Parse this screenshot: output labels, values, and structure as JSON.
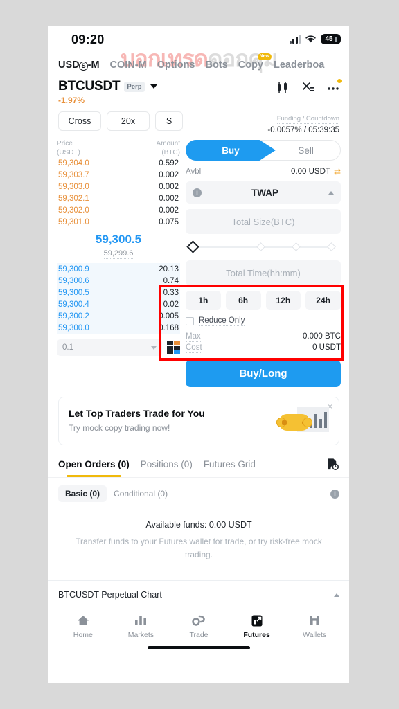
{
  "status_bar": {
    "time": "09:20",
    "battery": "45"
  },
  "watermark": {
    "part1": "บอกเทรด",
    "part2": "ดอกคุม"
  },
  "top_nav": {
    "items": [
      {
        "label_a": "USD",
        "label_b": "S",
        "label_c": "-M",
        "active": true
      },
      {
        "label": "COIN-M"
      },
      {
        "label": "Options"
      },
      {
        "label": "Bots"
      },
      {
        "label": "Copy",
        "badge": "New"
      },
      {
        "label": "Leaderboa"
      }
    ]
  },
  "ticker": {
    "symbol": "BTCUSDT",
    "perp_tag": "Perp",
    "change": "-1.97%",
    "chips": [
      "Cross",
      "20x",
      "S"
    ],
    "funding_label": "Funding / Countdown",
    "funding_value": "-0.0057% / 05:39:35"
  },
  "orderbook": {
    "head_price": "Price",
    "head_price_unit": "(USDT)",
    "head_amount": "Amount",
    "head_amount_unit": "(BTC)",
    "asks": [
      {
        "price": "59,304.0",
        "amount": "0.592"
      },
      {
        "price": "59,303.7",
        "amount": "0.002"
      },
      {
        "price": "59,303.0",
        "amount": "0.002"
      },
      {
        "price": "59,302.1",
        "amount": "0.002"
      },
      {
        "price": "59,302.0",
        "amount": "0.002"
      },
      {
        "price": "59,301.0",
        "amount": "0.075"
      }
    ],
    "mark_price": "59,300.5",
    "index_price": "59,299.6",
    "bids": [
      {
        "price": "59,300.9",
        "amount": "20.13"
      },
      {
        "price": "59,300.6",
        "amount": "0.74"
      },
      {
        "price": "59,300.5",
        "amount": "0.33"
      },
      {
        "price": "59,300.4",
        "amount": "0.02"
      },
      {
        "price": "59,300.2",
        "amount": "0.005"
      },
      {
        "price": "59,300.0",
        "amount": "0.168"
      }
    ],
    "tick_size": "0.1"
  },
  "order_form": {
    "buy_label": "Buy",
    "sell_label": "Sell",
    "avbl_label": "Avbl",
    "avbl_value": "0.00 USDT",
    "order_type": "TWAP",
    "size_placeholder": "Total Size(BTC)",
    "time_placeholder": "Total Time(hh:mm)",
    "time_buttons": [
      "1h",
      "6h",
      "12h",
      "24h"
    ],
    "reduce_only": "Reduce Only",
    "max_label": "Max",
    "max_value": "0.000 BTC",
    "cost_label": "Cost",
    "cost_value": "0 USDT",
    "cta": "Buy/Long"
  },
  "promo": {
    "title": "Let Top Traders Trade for You",
    "subtitle": "Try mock copy trading now!",
    "close": "×"
  },
  "orders": {
    "tabs": [
      {
        "label": "Open Orders (0)",
        "active": true
      },
      {
        "label": "Positions (0)",
        "active": false
      },
      {
        "label": "Futures Grid",
        "active": false
      }
    ],
    "sub_tabs": [
      {
        "label": "Basic (0)",
        "active": true
      },
      {
        "label": "Conditional (0)",
        "active": false
      }
    ],
    "empty_line1": "Available funds: 0.00 USDT",
    "empty_line2": "Transfer funds to your Futures wallet for trade, or try risk-free mock trading."
  },
  "chart_bar": {
    "label": "BTCUSDT Perpetual  Chart"
  },
  "bottom_nav": {
    "items": [
      {
        "label": "Home",
        "active": false
      },
      {
        "label": "Markets",
        "active": false
      },
      {
        "label": "Trade",
        "active": false
      },
      {
        "label": "Futures",
        "active": true
      },
      {
        "label": "Wallets",
        "active": false
      }
    ]
  },
  "colors": {
    "accent_blue": "#1e9bf0",
    "ask_orange": "#e8903a",
    "bid_blue": "#2196f3",
    "brand_yellow": "#f0b90b",
    "highlight_red": "#ff0000"
  }
}
